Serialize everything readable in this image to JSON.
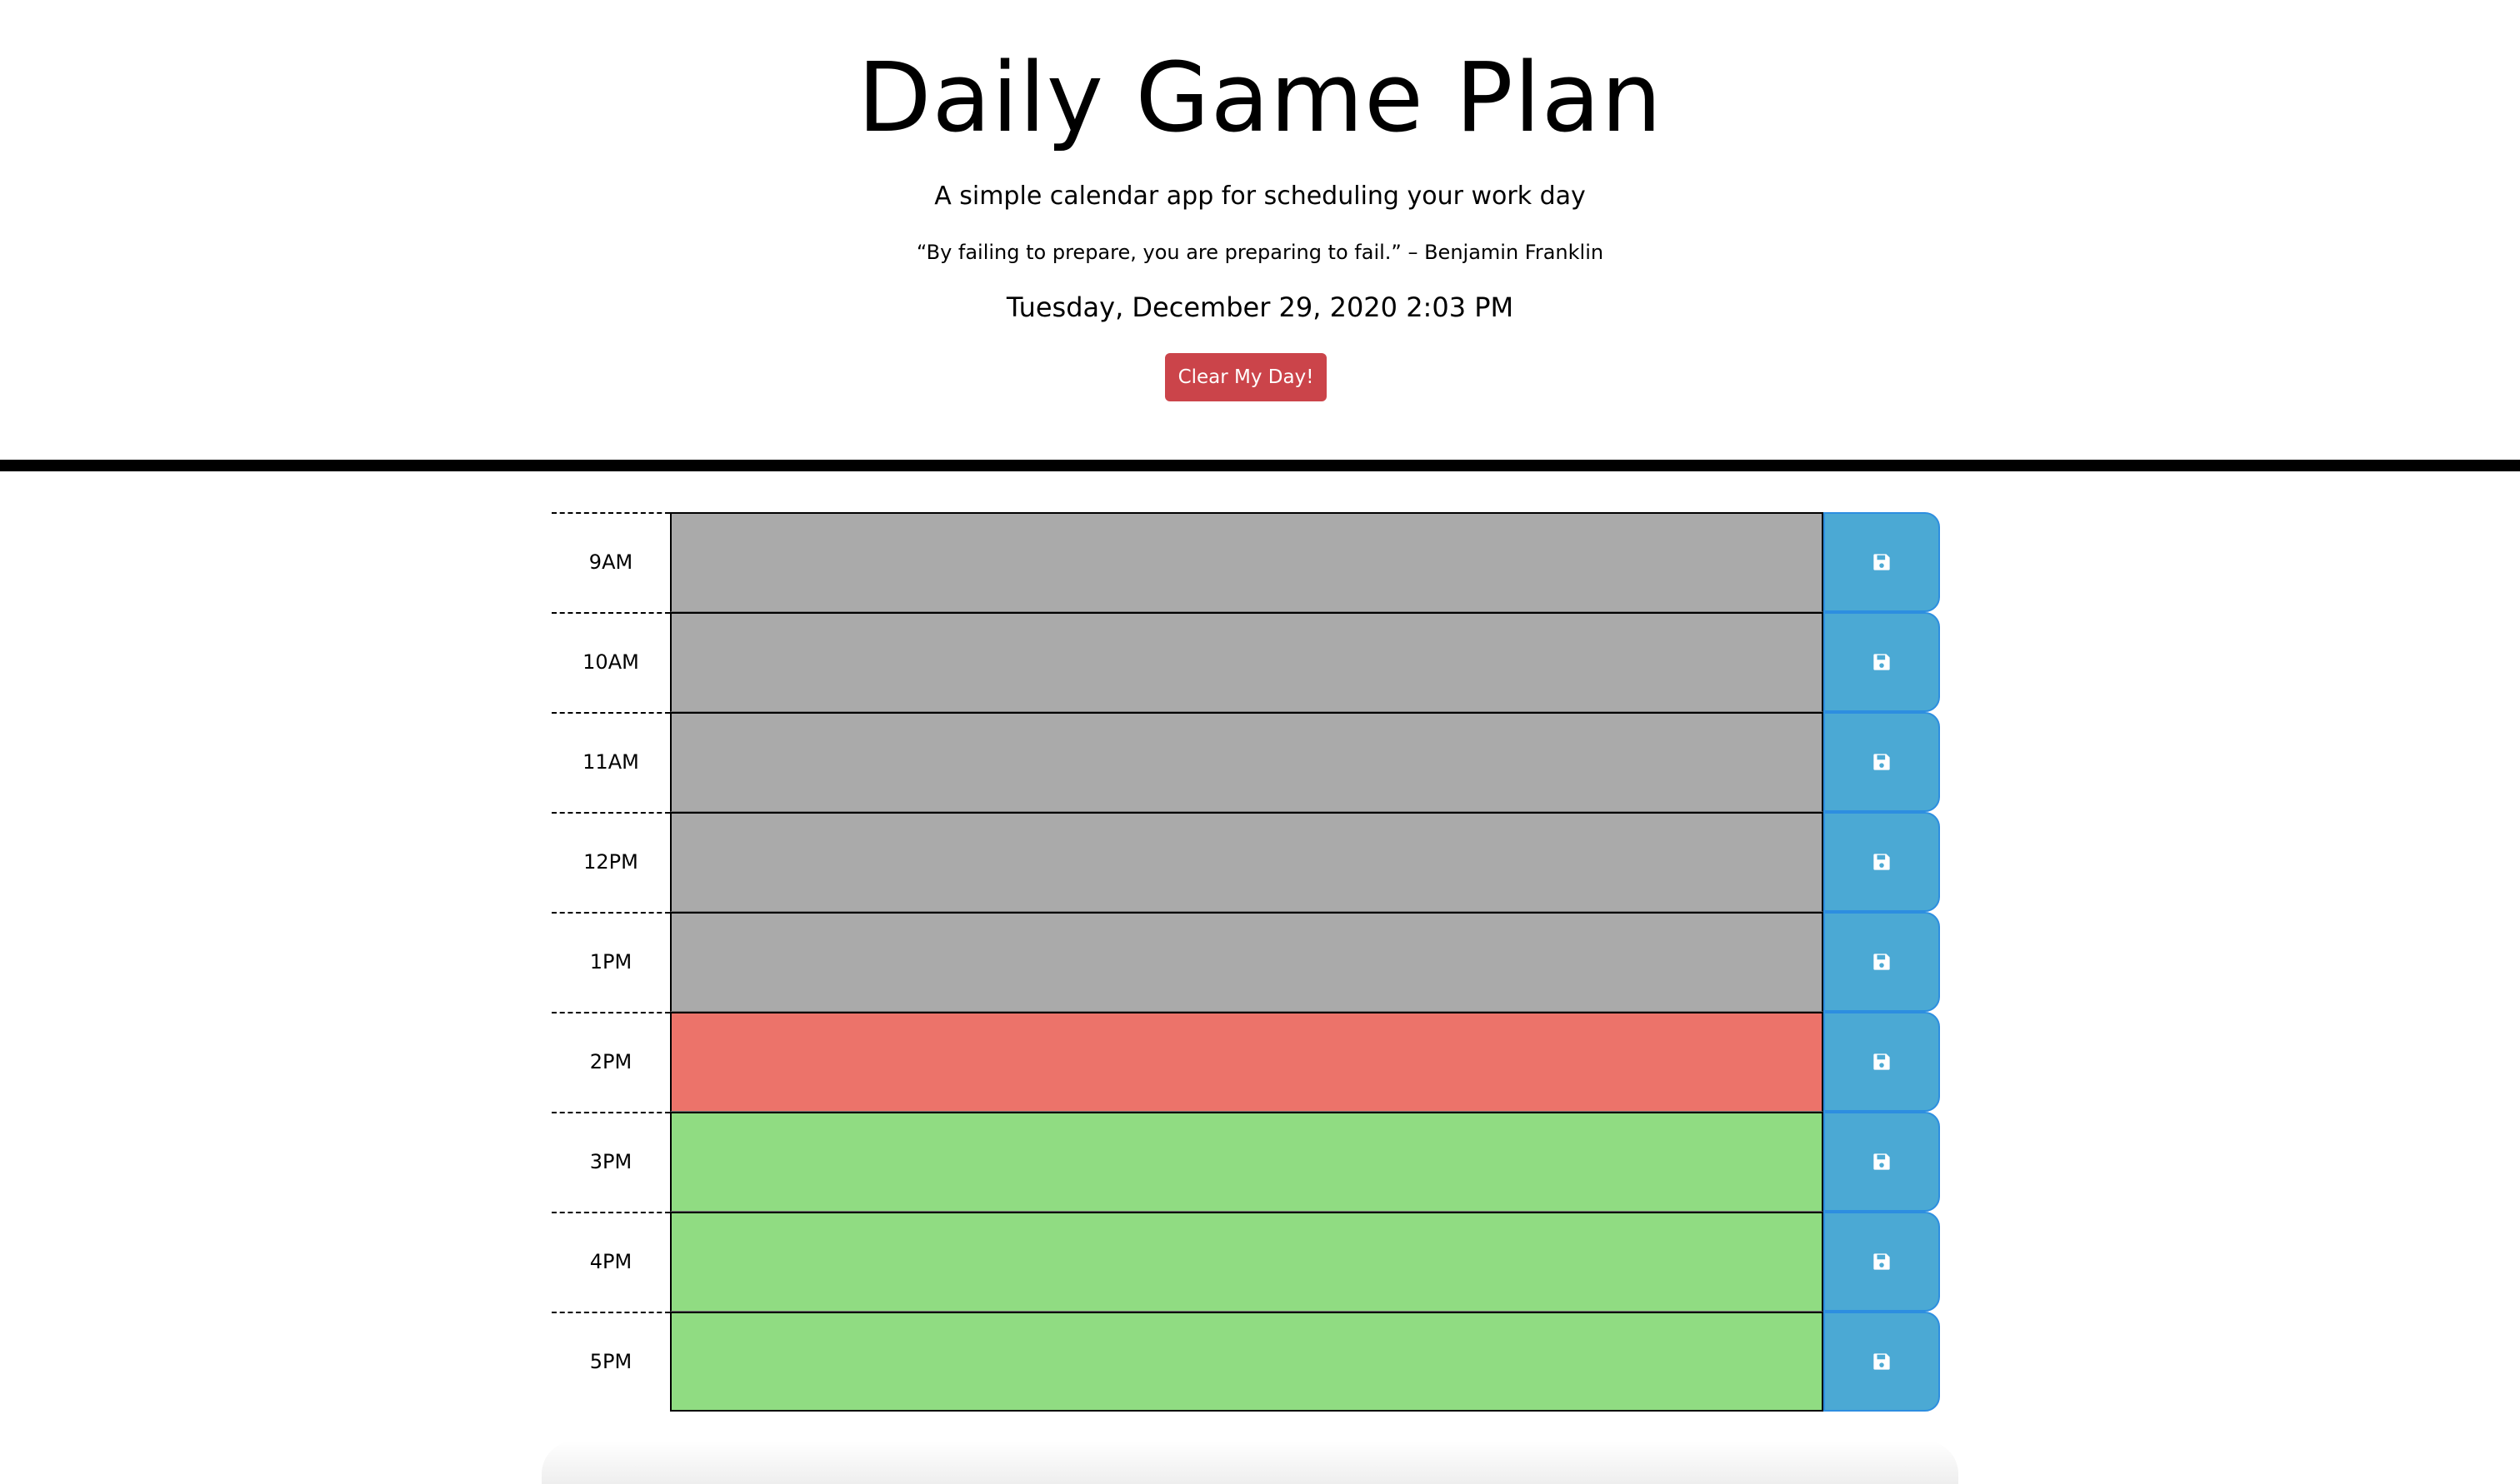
{
  "header": {
    "title": "Daily Game Plan",
    "lead": "A simple calendar app for scheduling your work day",
    "quote": "“By failing to prepare, you are preparing to fail.” – Benjamin Franklin",
    "current_day": "Tuesday, December 29, 2020 2:03 PM",
    "clear_button_label": "Clear My Day!",
    "clear_button_color": "#cb444a"
  },
  "colors": {
    "past": "#aaaaaa",
    "present": "#ec736a",
    "future": "#90dc82",
    "save_button": "#4ba9d4",
    "divider": "#000000"
  },
  "schedule": {
    "rows": [
      {
        "hour": "9AM",
        "status": "past",
        "text": "",
        "save_icon": "floppy-disk-icon"
      },
      {
        "hour": "10AM",
        "status": "past",
        "text": "",
        "save_icon": "floppy-disk-icon"
      },
      {
        "hour": "11AM",
        "status": "past",
        "text": "",
        "save_icon": "floppy-disk-icon"
      },
      {
        "hour": "12PM",
        "status": "past",
        "text": "",
        "save_icon": "floppy-disk-icon"
      },
      {
        "hour": "1PM",
        "status": "past",
        "text": "",
        "save_icon": "floppy-disk-icon"
      },
      {
        "hour": "2PM",
        "status": "present",
        "text": "",
        "save_icon": "floppy-disk-icon"
      },
      {
        "hour": "3PM",
        "status": "future",
        "text": "",
        "save_icon": "floppy-disk-icon"
      },
      {
        "hour": "4PM",
        "status": "future",
        "text": "",
        "save_icon": "floppy-disk-icon"
      },
      {
        "hour": "5PM",
        "status": "future",
        "text": "",
        "save_icon": "floppy-disk-icon"
      }
    ]
  }
}
